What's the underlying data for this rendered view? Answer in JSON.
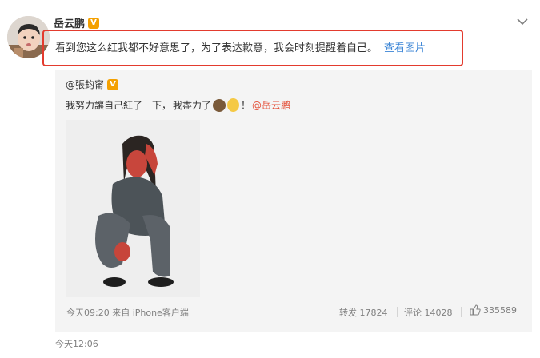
{
  "post": {
    "author": "岳云鹏",
    "badge": "V",
    "text": "看到您这么红我都不好意思了，为了表达歉意，我会时刻提醒着自己。",
    "view_image_link": "查看图片"
  },
  "repost": {
    "author": "@張鈞甯",
    "badge": "V",
    "text_before": "我努力讓自己紅了一下，",
    "text_middle": "我盡力了",
    "text_after": "！",
    "mention": "@岳云鹏",
    "meta": "今天09:20 来自 iPhone客户端",
    "repost_count": "转发 17824",
    "comment_count": "评论 14028",
    "like_count": "335589"
  },
  "post_time": "今天12:06",
  "icons": {
    "menu": "chevron-down-icon",
    "like": "thumbs-up-icon",
    "emoji_1": "monkey-face-icon",
    "emoji_2": "hand-over-mouth-icon"
  },
  "colors": {
    "highlight_border": "#e33b2e",
    "link": "#3b85d6",
    "mention": "#e4513a",
    "badge": "#f4a000"
  }
}
